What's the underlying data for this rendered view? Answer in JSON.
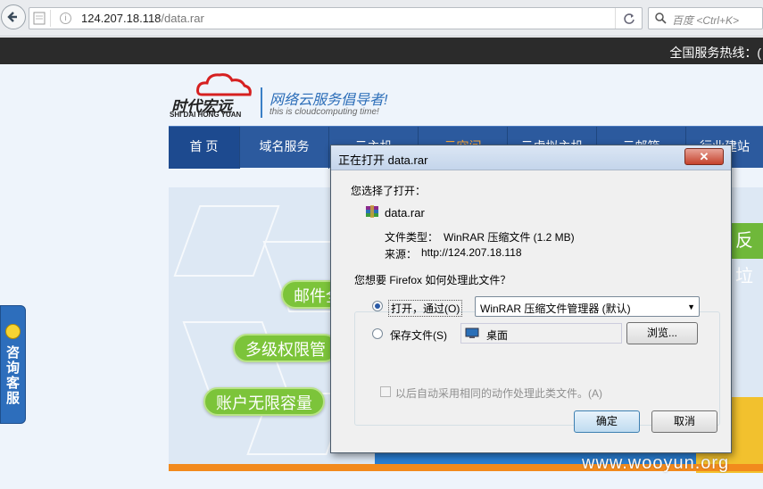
{
  "browser": {
    "url_host": "124.207.18.118",
    "url_path": "/data.rar",
    "search_placeholder": "百度 <Ctrl+K>"
  },
  "site": {
    "hotline": "全国服务热线：(",
    "logo_cn": "时代宏远",
    "logo_en": "SHI DAI HONG YUAN",
    "slogan_cn": "网络云服务倡导者!",
    "slogan_en": "this is cloudcomputing time!",
    "nav": [
      "首 页",
      "域名服务",
      "云主机",
      "云空间",
      "云虚拟主机",
      "云邮箱",
      "行业建站"
    ],
    "pills": [
      "邮件全",
      "多级权限管",
      "账户无限容量"
    ],
    "banner_right_text": "反垃",
    "consult": "咨询客服",
    "watermark": "www.wooyun.org",
    "colors": {
      "nav": "#2c5a9e",
      "pill": "#7cc43a",
      "stripe": "#f28a1d"
    }
  },
  "dialog": {
    "title": "正在打开 data.rar",
    "close_label": "✕",
    "you_chose": "您选择了打开：",
    "file_name": "data.rar",
    "file_type_label": "文件类型：",
    "file_type_value": "WinRAR 压缩文件 (1.2 MB)",
    "source_label": "来源：",
    "source_value": "http://124.207.18.118",
    "question": "您想要 Firefox 如何处理此文件？",
    "open_with_label": "打开，通过(O)",
    "open_with_app": "WinRAR 压缩文件管理器 (默认)",
    "save_label": "保存文件(S)",
    "save_path": "桌面",
    "browse_label": "浏览...",
    "auto_label": "以后自动采用相同的动作处理此类文件。(A)",
    "ok_label": "确定",
    "cancel_label": "取消"
  }
}
